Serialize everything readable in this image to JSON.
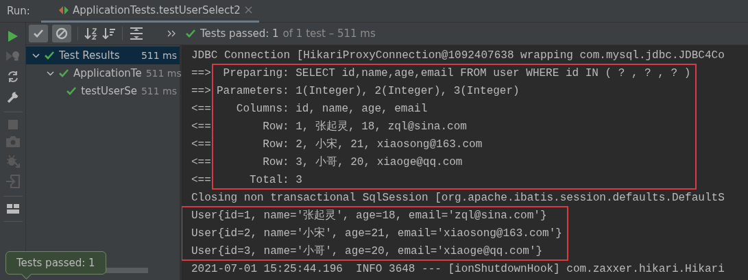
{
  "run_bar": {
    "label": "Run:",
    "tab": {
      "title": "ApplicationTests.testUserSelect2",
      "selected": true
    }
  },
  "toolbar": {
    "toggles": [
      {
        "on": true
      },
      {
        "on": true
      }
    ],
    "status": {
      "summary": "Tests passed: 1",
      "detail": "of 1 test – 511 ms"
    }
  },
  "tree": [
    {
      "label": "Test Results",
      "time": "511 ms",
      "selected": true,
      "passed": true,
      "expanded": true,
      "children": [
        {
          "label": "ApplicationTe",
          "time": "511 ms",
          "selected": false,
          "passed": true,
          "expanded": true,
          "children": [
            {
              "label": "testUserSe",
              "time": "511 ms",
              "selected": false,
              "passed": true
            }
          ]
        }
      ]
    }
  ],
  "console": {
    "blocks": [
      {
        "highlighted": false,
        "lines": [
          {
            "text": "JDBC Connection [HikariProxyConnection@1092407638 wrapping com.mysql.jdbc.JDBC4Co"
          }
        ]
      },
      {
        "highlighted": true,
        "lines": [
          {
            "prefix": "==>",
            "text": " Preparing: SELECT id,name,age,email FROM user WHERE id IN ( ? , ? , ? )"
          },
          {
            "prefix": "==>",
            "text": "Parameters: 1(Integer), 2(Integer), 3(Integer)"
          },
          {
            "prefix": "<==",
            "text": "   Columns: id, name, age, email"
          },
          {
            "prefix": "<==",
            "text": "       Row: 1, 张起灵, 18, zql@sina.com"
          },
          {
            "prefix": "<==",
            "text": "       Row: 2, 小宋, 21, xiaosong@163.com"
          },
          {
            "prefix": "<==",
            "text": "       Row: 3, 小哥, 20, xiaoge@qq.com"
          },
          {
            "prefix": "<==",
            "text": "     Total: 3"
          }
        ]
      },
      {
        "highlighted": false,
        "lines": [
          {
            "text": "Closing non transactional SqlSession [org.apache.ibatis.session.defaults.DefaultS"
          }
        ]
      },
      {
        "highlighted": true,
        "lines": [
          {
            "text": "User{id=1, name='张起灵', age=18, email='zql@sina.com'}"
          },
          {
            "text": "User{id=2, name='小宋', age=21, email='xiaosong@163.com'}"
          },
          {
            "text": "User{id=3, name='小哥', age=20, email='xiaoge@qq.com'}"
          }
        ]
      },
      {
        "highlighted": false,
        "lines": [
          {
            "text": "2021-07-01 15:25:44.196  INFO 3648 --- [ionShutdownHook] com.zaxxer.hikari.Hikari"
          }
        ]
      }
    ]
  },
  "tooltip": {
    "text": "Tests passed: 1"
  }
}
